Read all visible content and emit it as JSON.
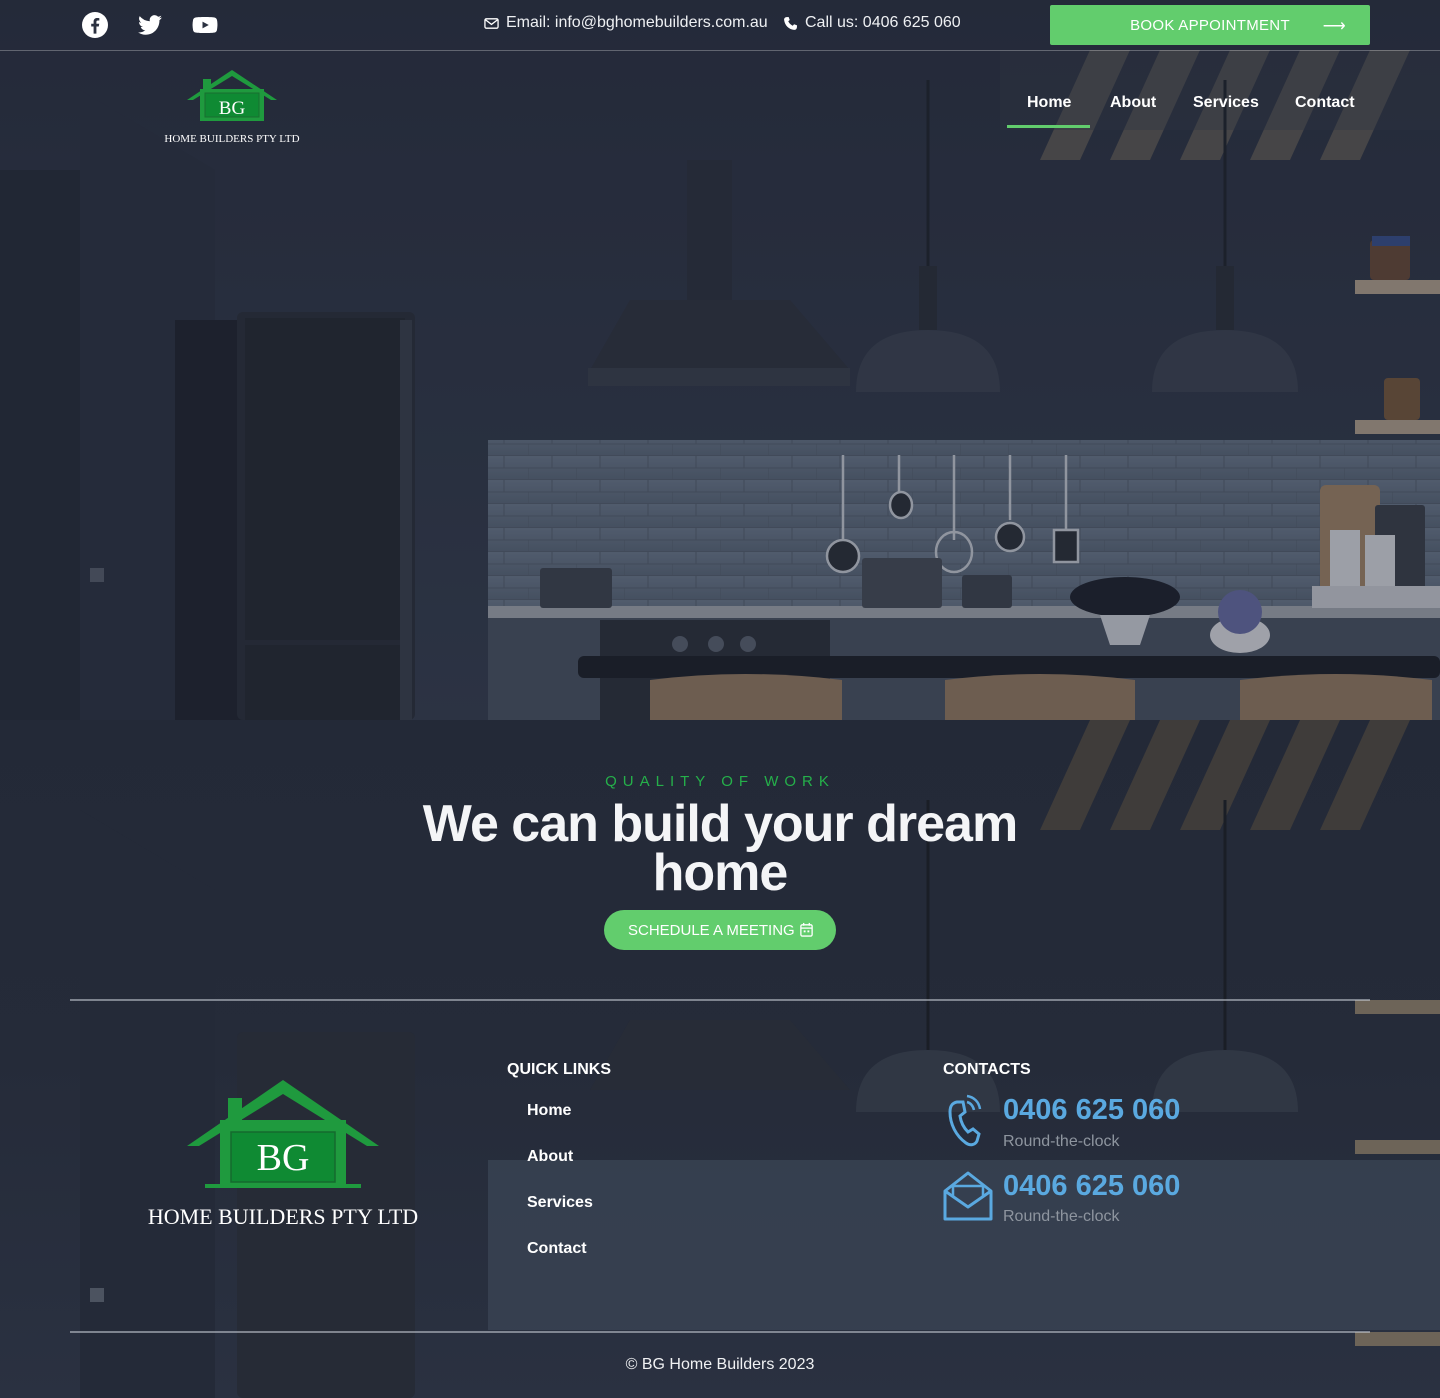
{
  "topbar": {
    "socials": [
      {
        "name": "facebook-icon"
      },
      {
        "name": "twitter-icon"
      },
      {
        "name": "youtube-icon"
      }
    ],
    "email_text": "Email: info@bghomebuilders.com.au",
    "phone_text": "Call us: 0406 625 060",
    "book_label": "BOOK APPOINTMENT"
  },
  "logo": {
    "initials": "BG",
    "company": "HOME BUILDERS  PTY LTD"
  },
  "nav": {
    "items": [
      {
        "label": "Home",
        "active": true
      },
      {
        "label": "About"
      },
      {
        "label": "Services"
      },
      {
        "label": "Contact"
      }
    ]
  },
  "cta": {
    "eyebrow": "QUALITY OF WORK",
    "headline": "We can build your dream home",
    "button": "SCHEDULE A MEETING"
  },
  "footer": {
    "quick_links_title": "QUICK LINKS",
    "quick_links": [
      "Home",
      "About",
      "Services",
      "Contact"
    ],
    "contacts_title": "CONTACTS",
    "contacts": [
      {
        "icon": "phone-ringing-icon",
        "number": "0406 625 060",
        "note": "Round-the-clock"
      },
      {
        "icon": "envelope-open-icon",
        "number": "0406 625 060",
        "note": "Round-the-clock"
      }
    ],
    "copyright": "© BG Home Builders 2023"
  },
  "colors": {
    "accent_green": "#62cd6d",
    "eyebrow_green": "#25b04a",
    "contact_blue": "#5aa9e0",
    "dark_bg": "#232937"
  }
}
